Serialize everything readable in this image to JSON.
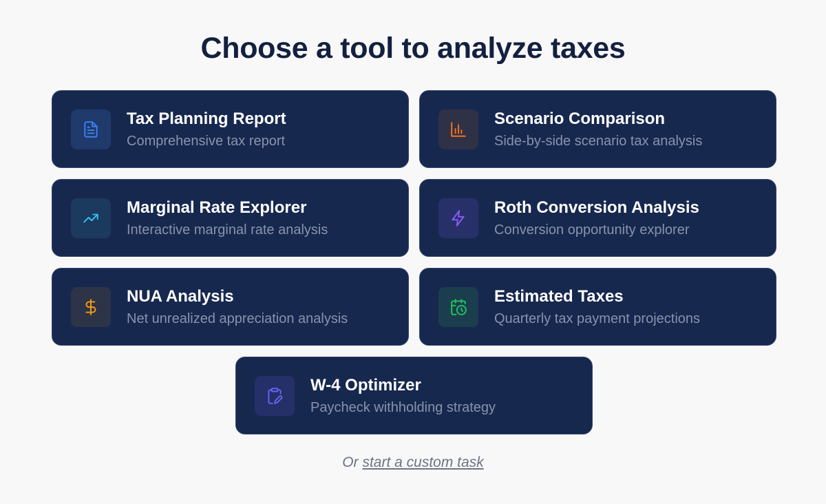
{
  "heading": "Choose a tool to analyze taxes",
  "tools": [
    {
      "title": "Tax Planning Report",
      "description": "Comprehensive tax report",
      "icon": "document-icon",
      "accent": "#3b82f6",
      "tile_bg": "#1f3a6b"
    },
    {
      "title": "Scenario Comparison",
      "description": "Side-by-side scenario tax analysis",
      "icon": "bar-chart-icon",
      "accent": "#f97316",
      "tile_bg": "#2f3147"
    },
    {
      "title": "Marginal Rate Explorer",
      "description": "Interactive marginal rate analysis",
      "icon": "trending-up-icon",
      "accent": "#38bdf8",
      "tile_bg": "#1c3a5e"
    },
    {
      "title": "Roth Conversion Analysis",
      "description": "Conversion opportunity explorer",
      "icon": "lightning-icon",
      "accent": "#8b5cf6",
      "tile_bg": "#28306a"
    },
    {
      "title": "NUA Analysis",
      "description": "Net unrealized appreciation analysis",
      "icon": "dollar-icon",
      "accent": "#f59e0b",
      "tile_bg": "#2e3448"
    },
    {
      "title": "Estimated Taxes",
      "description": "Quarterly tax payment projections",
      "icon": "calendar-clock-icon",
      "accent": "#22c55e",
      "tile_bg": "#1b3e4e"
    },
    {
      "title": "W-4 Optimizer",
      "description": "Paycheck withholding strategy",
      "icon": "clipboard-pen-icon",
      "accent": "#6366f1",
      "tile_bg": "#252f68"
    }
  ],
  "footer": {
    "prefix": "Or ",
    "link": "start a custom task"
  }
}
